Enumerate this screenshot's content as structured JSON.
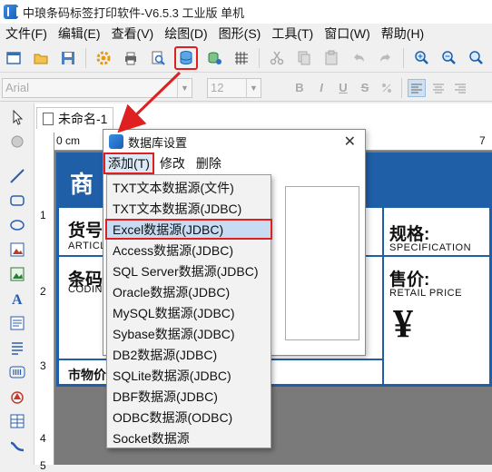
{
  "window": {
    "title": "中琅条码标签打印软件-V6.5.3 工业版 单机"
  },
  "menubar": {
    "items": [
      "文件(F)",
      "编辑(E)",
      "查看(V)",
      "绘图(D)",
      "图形(S)",
      "工具(T)",
      "窗口(W)",
      "帮助(H)"
    ]
  },
  "fontbar": {
    "font_name": "Arial",
    "font_size": "12",
    "bold": "B",
    "italic": "I",
    "underline": "U",
    "strike": "S"
  },
  "document": {
    "tab_label": "未命名-1"
  },
  "ruler": {
    "top_ticks": [
      "0 cm",
      "1",
      "7"
    ],
    "left_ticks": [
      "1",
      "2",
      "3",
      "4",
      "5"
    ]
  },
  "label_design": {
    "header_char": "商",
    "fields": [
      {
        "cn": "货号",
        "en": "ARTICL"
      },
      {
        "cn": "条码",
        "en": "CODIN"
      },
      {
        "cn": "规格:",
        "en": "SPECIFICATION"
      },
      {
        "cn": "售价:",
        "en": "RETAIL PRICE"
      },
      {
        "cn": "市物价",
        "en": ""
      }
    ],
    "currency_symbol": "¥"
  },
  "dialog": {
    "title": "数据库设置",
    "close_glyph": "✕",
    "menu": [
      "添加(T)",
      "修改",
      "删除"
    ]
  },
  "dropdown": {
    "items": [
      "TXT文本数据源(文件)",
      "TXT文本数据源(JDBC)",
      "Excel数据源(JDBC)",
      "Access数据源(JDBC)",
      "SQL Server数据源(JDBC)",
      "Oracle数据源(JDBC)",
      "MySQL数据源(JDBC)",
      "Sybase数据源(JDBC)",
      "DB2数据源(JDBC)",
      "SQLite数据源(JDBC)",
      "DBF数据源(JDBC)",
      "ODBC数据源(ODBC)",
      "Socket数据源"
    ],
    "selected_index": 2
  },
  "colors": {
    "accent": "#1f5fa8",
    "highlight_red": "#e02020",
    "selection_blue": "#c7dcf2"
  }
}
